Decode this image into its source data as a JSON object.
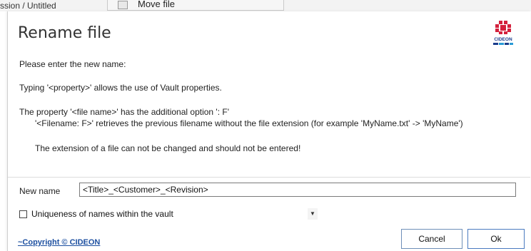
{
  "background": {
    "left_text": "ssion / Untitled",
    "panel_text": "Move file"
  },
  "dialog": {
    "title": "Rename file",
    "logo_text": "CIDEON",
    "prompt": "Please enter the new name:",
    "hint_properties": "Typing '<property>' allows the use of Vault properties.",
    "hint_filename_option": "The property '<file name>' has the additional option ': F'",
    "hint_filename_example": "'<Filename: F>' retrieves the previous filename without the file extension (for example 'MyName.txt' -> 'MyName')",
    "hint_extension": "The extension of a file can not be changed and should not be entered!",
    "new_name_label": "New name",
    "new_name_value": "<Title>_<Customer>_<Revision>",
    "uniqueness_label": "Uniqueness of names within the vault",
    "uniqueness_checked": false,
    "copyright_link": "~Copyright © CIDEON",
    "cancel_label": "Cancel",
    "ok_label": "Ok"
  },
  "colors": {
    "logo_red": "#d4213d",
    "logo_blue": "#1a3c8c",
    "link": "#1c4fa0",
    "button_border": "#6e8fb8"
  }
}
